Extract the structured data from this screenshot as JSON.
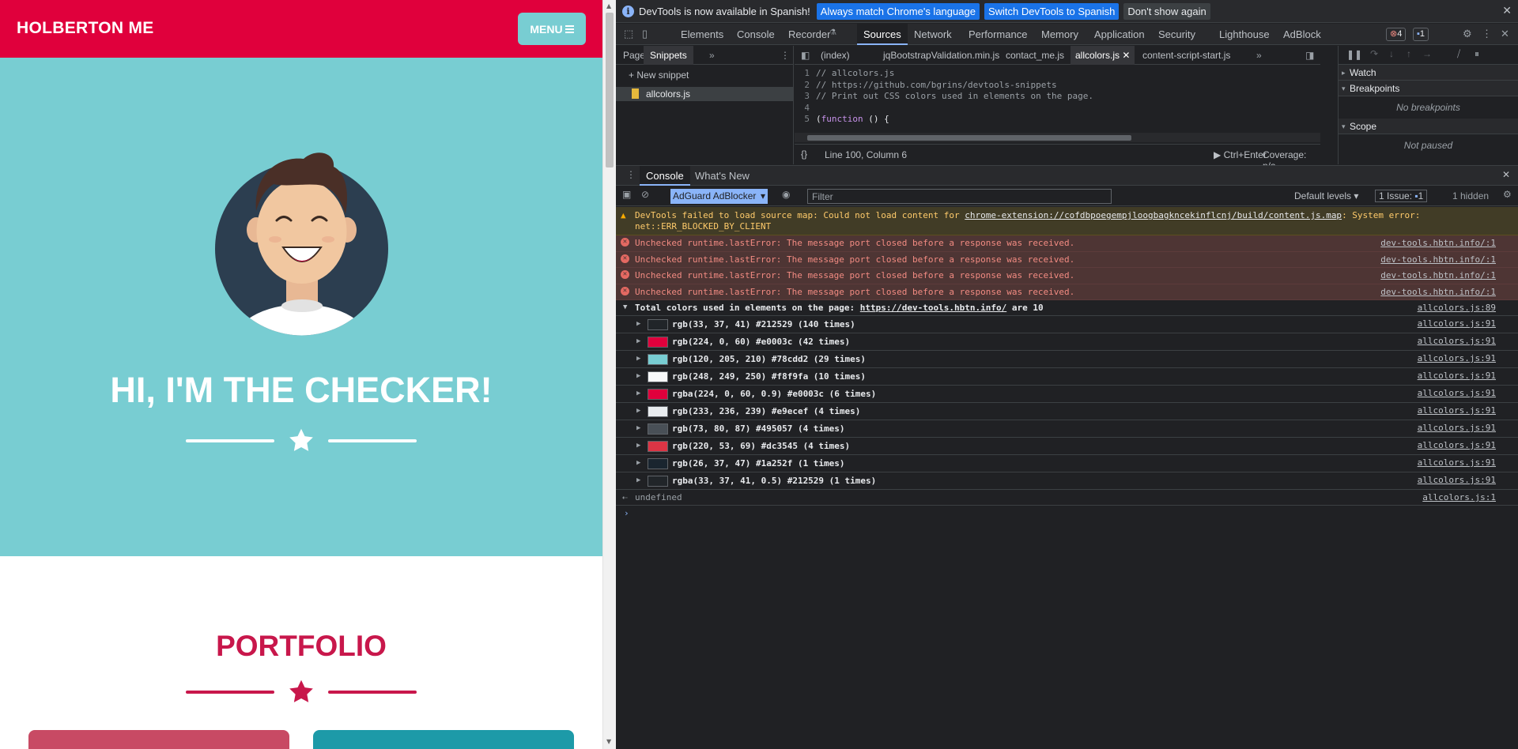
{
  "site": {
    "brand": "HOLBERTON ME",
    "menu_label": "MENU",
    "hero_title": "HI, I'M THE CHECKER!",
    "portfolio_title": "PORTFOLIO"
  },
  "devtools": {
    "infobar": {
      "message": "DevTools is now available in Spanish!",
      "btn_match": "Always match Chrome's language",
      "btn_switch": "Switch DevTools to Spanish",
      "btn_dismiss": "Don't show again"
    },
    "tabs": [
      "Elements",
      "Console",
      "Recorder",
      "Sources",
      "Network",
      "Performance",
      "Memory",
      "Application",
      "Security",
      "Lighthouse",
      "AdBlock"
    ],
    "active_tab": "Sources",
    "error_count": "4",
    "message_count": "1",
    "nav_tabs": {
      "page": "Page",
      "snippets": "Snippets"
    },
    "new_snippet": "New snippet",
    "snippet_name": "allcolors.js",
    "file_tabs": [
      "(index)",
      "jqBootstrapValidation.min.js",
      "contact_me.js",
      "allcolors.js",
      "content-script-start.js"
    ],
    "code_lines": [
      {
        "n": "1",
        "text": "// allcolors.js"
      },
      {
        "n": "2",
        "text": "// https://github.com/bgrins/devtools-snippets"
      },
      {
        "n": "3",
        "text": "// Print out CSS colors used in elements on the page."
      },
      {
        "n": "4",
        "text": ""
      },
      {
        "n": "5",
        "kw": "function",
        "pre": "(",
        "post": " () {"
      }
    ],
    "status": {
      "position": "Line 100, Column 6",
      "run": "Ctrl+Enter",
      "coverage": "Coverage: n/a"
    },
    "debugger": {
      "watch": "Watch",
      "breakpoints": "Breakpoints",
      "no_breakpoints": "No breakpoints",
      "scope": "Scope",
      "not_paused": "Not paused"
    },
    "drawer_tabs": {
      "console": "Console",
      "whats_new": "What's New"
    },
    "console_toolbar": {
      "context": "AdGuard AdBlocker",
      "filter_placeholder": "Filter",
      "levels": "Default levels",
      "issues_label": "1 Issue:",
      "issues_count": "1",
      "hidden": "1 hidden"
    },
    "warning": {
      "prefix": "DevTools failed to load source map: Could not load content for ",
      "link": "chrome-extension://cofdbpoegempjloogbagkncekinflcnj/build/content.js.map",
      "suffix": ": System error:",
      "line2": "net::ERR_BLOCKED_BY_CLIENT"
    },
    "errors": [
      {
        "text": "Unchecked runtime.lastError: The message port closed before a response was received.",
        "src": "dev-tools.hbtn.info/:1"
      },
      {
        "text": "Unchecked runtime.lastError: The message port closed before a response was received.",
        "src": "dev-tools.hbtn.info/:1"
      },
      {
        "text": "Unchecked runtime.lastError: The message port closed before a response was received.",
        "src": "dev-tools.hbtn.info/:1"
      },
      {
        "text": "Unchecked runtime.lastError: The message port closed before a response was received.",
        "src": "dev-tools.hbtn.info/:1"
      }
    ],
    "group": {
      "prefix": "Total colors used in elements on the page: ",
      "link": "https://dev-tools.hbtn.info/",
      "suffix": " are 10",
      "src": "allcolors.js:89"
    },
    "colors": [
      {
        "swatch": "#212529",
        "text": "rgb(33, 37, 41) #212529 (140 times)",
        "src": "allcolors.js:91"
      },
      {
        "swatch": "#e0003c",
        "text": "rgb(224, 0, 60) #e0003c (42 times)",
        "src": "allcolors.js:91"
      },
      {
        "swatch": "#78cdd2",
        "text": "rgb(120, 205, 210) #78cdd2 (29 times)",
        "src": "allcolors.js:91"
      },
      {
        "swatch": "#f8f9fa",
        "text": "rgb(248, 249, 250) #f8f9fa (10 times)",
        "src": "allcolors.js:91"
      },
      {
        "swatch": "#e0003c",
        "text": "rgba(224, 0, 60, 0.9) #e0003c (6 times)",
        "src": "allcolors.js:91"
      },
      {
        "swatch": "#e9ecef",
        "text": "rgb(233, 236, 239) #e9ecef (4 times)",
        "src": "allcolors.js:91"
      },
      {
        "swatch": "#495057",
        "text": "rgb(73, 80, 87) #495057 (4 times)",
        "src": "allcolors.js:91"
      },
      {
        "swatch": "#dc3545",
        "text": "rgb(220, 53, 69) #dc3545 (4 times)",
        "src": "allcolors.js:91"
      },
      {
        "swatch": "#1a252f",
        "text": "rgb(26, 37, 47) #1a252f (1 times)",
        "src": "allcolors.js:91"
      },
      {
        "swatch": "#212529",
        "text": "rgba(33, 37, 41, 0.5) #212529 (1 times)",
        "src": "allcolors.js:91"
      }
    ],
    "return_value": "undefined",
    "return_src": "allcolors.js:1",
    "prompt": "›"
  }
}
